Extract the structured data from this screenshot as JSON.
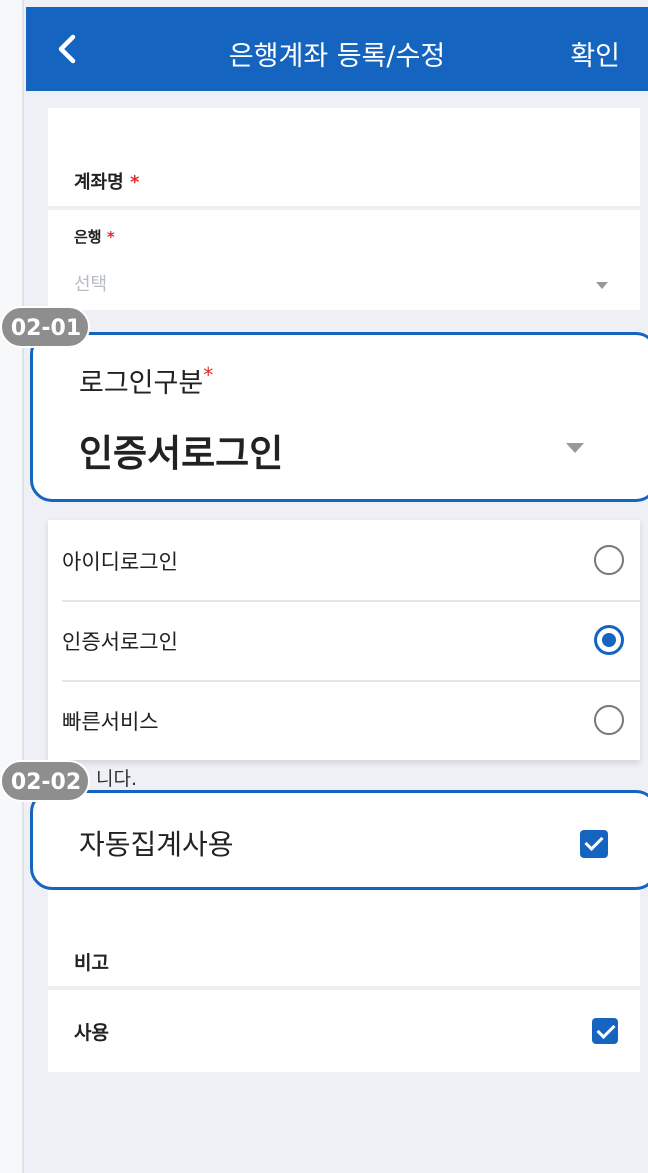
{
  "header": {
    "title": "은행계좌 등록/수정",
    "confirm_label": "확인"
  },
  "form": {
    "account_name_label": "계좌명",
    "bank_label": "은행",
    "bank_placeholder": "선택",
    "required_mark": "*",
    "memo_label": "비고",
    "use_label": "사용",
    "use_checked": true
  },
  "callouts": {
    "login": {
      "badge": "02-01",
      "label": "로그인구분",
      "value": "인증서로그인"
    },
    "auto": {
      "badge": "02-02",
      "label": "자동집계사용",
      "checked": true
    }
  },
  "login_options": [
    {
      "label": "아이디로그인",
      "selected": false
    },
    {
      "label": "인증서로그인",
      "selected": true
    },
    {
      "label": "빠른서비스",
      "selected": false
    }
  ],
  "partial_text": "니다.",
  "colors": {
    "primary": "#1565c0",
    "required": "#e02b2b",
    "background": "#eef0f5"
  }
}
